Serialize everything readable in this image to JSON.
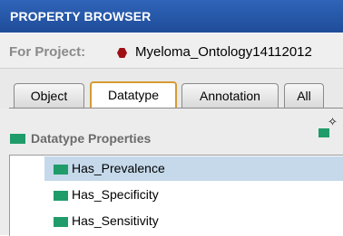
{
  "header": {
    "title": "PROPERTY BROWSER"
  },
  "project": {
    "label": "For Project:",
    "name": "Myeloma_Ontology14112012"
  },
  "tabs": [
    "Object",
    "Datatype",
    "Annotation",
    "All"
  ],
  "active_tab": "Datatype",
  "section": {
    "title": "Datatype Properties"
  },
  "properties": [
    "Has_Prevalence",
    "Has_Specificity",
    "Has_Sensitivity"
  ],
  "selected_property": "Has_Prevalence",
  "colors": {
    "titlebar": "#1f4c99",
    "property_icon": "#1f9c6a",
    "project_icon": "#9e1015",
    "selection": "#c5d9ea",
    "active_tab_border": "#d69b33"
  }
}
